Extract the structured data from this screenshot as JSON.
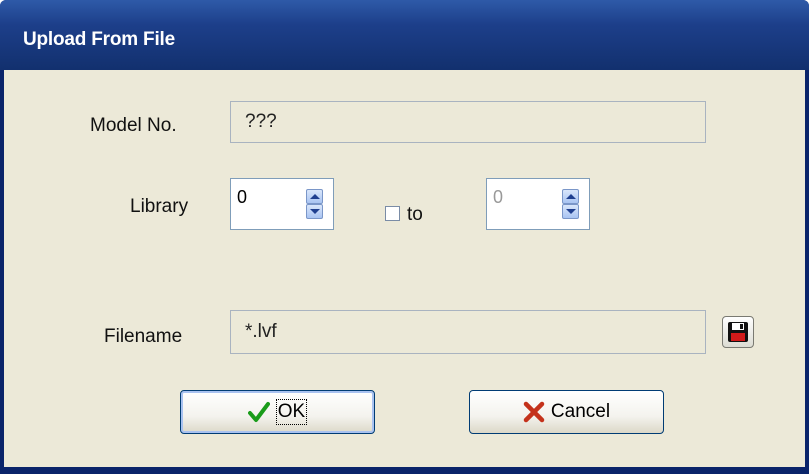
{
  "window": {
    "title": "Upload From File"
  },
  "model": {
    "label": "Model No.",
    "value": "???"
  },
  "library": {
    "label": "Library",
    "from_value": "0",
    "range_checkbox_label": "to",
    "range_checked": false,
    "to_value": "0"
  },
  "filename": {
    "label": "Filename",
    "value": "*.lvf"
  },
  "buttons": {
    "ok_label": "OK",
    "cancel_label": "Cancel"
  },
  "colors": {
    "titlebar": "#1d3f8a",
    "client": "#ece9d8",
    "ok_check": "#1a9c1a",
    "cancel_x": "#c4321b"
  },
  "icons": {
    "ok": "checkmark-icon",
    "cancel": "x-icon",
    "browse": "floppy-disk-icon",
    "spin_up": "triangle-up-icon",
    "spin_down": "triangle-down-icon"
  }
}
